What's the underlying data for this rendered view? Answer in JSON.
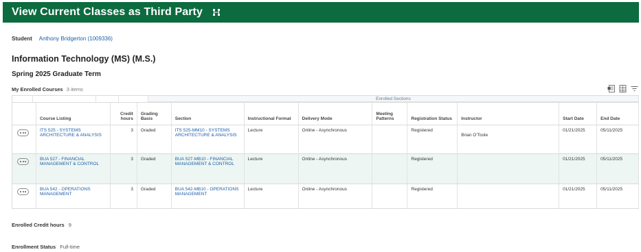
{
  "header": {
    "title": "View Current Classes as Third Party"
  },
  "student": {
    "label": "Student",
    "name": "Anthony Bridgerton (1009336)"
  },
  "program": "Information Technology (MS) (M.S.)",
  "term": "Spring 2025 Graduate Term",
  "enrolled": {
    "title": "My Enrolled Courses",
    "count": "3 items",
    "group_label": "Enrolled Sections"
  },
  "columns": {
    "course": "Course Listing",
    "credit": "Credit hours",
    "grading": "Grading Basis",
    "section": "Section",
    "format": "Instructional Format",
    "delivery": "Delivery Mode",
    "meeting": "Meeting Patterns",
    "registration": "Registration Status",
    "instructor": "Instructor",
    "start": "Start Date",
    "end": "End Date"
  },
  "rows": [
    {
      "course": "ITS 525 - SYSTEMS ARCHITECTURE & ANALYSIS",
      "credit": "3",
      "grading": "Graded",
      "section": "ITS 525-MM10 - SYSTEMS ARCHITECTURE & ANALYSIS",
      "format": "Lecture",
      "delivery": "Online - Asynchronous",
      "meeting": "",
      "registration": "Registered",
      "instructor": "Brian O'Toole",
      "start": "01/21/2025",
      "end": "05/11/2025"
    },
    {
      "course": "BUA 527 - FINANCIAL MANAGEMENT & CONTROL",
      "credit": "3",
      "grading": "Graded",
      "section": "BUA 527-MB10 - FINANCIAL MANAGEMENT & CONTROL",
      "format": "Lecture",
      "delivery": "Online - Asynchronous",
      "meeting": "",
      "registration": "Registered",
      "instructor": "",
      "start": "01/21/2025",
      "end": "05/11/2025"
    },
    {
      "course": "BUA 542 - OPERATIONS MANAGEMENT",
      "credit": "3",
      "grading": "Graded",
      "section": "BUA 542-MB10 - OPERATIONS MANAGEMENT",
      "format": "Lecture",
      "delivery": "Online - Asynchronous",
      "meeting": "",
      "registration": "Registered",
      "instructor": "",
      "start": "01/21/2025",
      "end": "05/11/2025"
    }
  ],
  "summary": {
    "credit_label": "Enrolled Credit hours",
    "credit_value": "9",
    "status_label": "Enrollment Status",
    "status_value": "Full-time"
  },
  "colors": {
    "header_bg": "#0c6b3f",
    "link": "#1a5ea8",
    "highlight_row": "#eef6f3"
  },
  "icons": [
    "org-chart-icon",
    "export-excel-icon",
    "table-view-icon",
    "filter-icon",
    "related-actions-icon"
  ]
}
